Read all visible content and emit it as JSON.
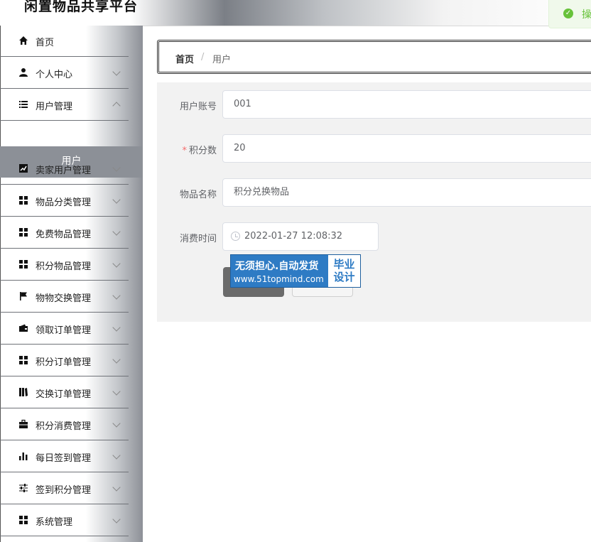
{
  "header": {
    "title": "闲置物品共享平台"
  },
  "toast": {
    "text": "操"
  },
  "sidebar": {
    "items": [
      {
        "label": "首页",
        "icon": "home-icon",
        "expandable": false
      },
      {
        "label": "个人中心",
        "icon": "user-icon",
        "expandable": true
      },
      {
        "label": "用户管理",
        "icon": "list-icon",
        "expandable": true
      },
      {
        "label": "卖家用户管理",
        "icon": "chart-icon",
        "expandable": true
      },
      {
        "label": "物品分类管理",
        "icon": "grid-icon",
        "expandable": true
      },
      {
        "label": "免费物品管理",
        "icon": "grid-icon",
        "expandable": true
      },
      {
        "label": "积分物品管理",
        "icon": "grid-icon",
        "expandable": true
      },
      {
        "label": "物物交换管理",
        "icon": "flag-icon",
        "expandable": true
      },
      {
        "label": "领取订单管理",
        "icon": "wallet-icon",
        "expandable": true
      },
      {
        "label": "积分订单管理",
        "icon": "grid-icon",
        "expandable": true
      },
      {
        "label": "交换订单管理",
        "icon": "book-icon",
        "expandable": true
      },
      {
        "label": "积分消费管理",
        "icon": "briefcase-icon",
        "expandable": true
      },
      {
        "label": "每日签到管理",
        "icon": "bar-chart-icon",
        "expandable": true
      },
      {
        "label": "签到积分管理",
        "icon": "sliders-icon",
        "expandable": true
      },
      {
        "label": "系统管理",
        "icon": "grid-icon",
        "expandable": true
      }
    ],
    "active_sub": "用户"
  },
  "breadcrumb": {
    "home": "首页",
    "separator": "/",
    "current": "用户"
  },
  "form": {
    "account": {
      "label": "用户账号",
      "value": "001"
    },
    "points": {
      "label": "积分数",
      "required_mark": "*",
      "value": "20"
    },
    "item_name": {
      "label": "物品名称",
      "value": "积分兑换物品"
    },
    "time": {
      "label": "消费时间",
      "value": "2022-01-27 12:08:32"
    }
  },
  "watermark": {
    "line1": "无须担心.自动发货",
    "line2": "www.51topmind.com",
    "right1": "毕业",
    "right2": "设计"
  },
  "colors": {
    "sidebar_active": "#8c9097",
    "primary_button": "#6b6b6b",
    "toast_success": "#67c23a",
    "required": "#f56c6c"
  }
}
